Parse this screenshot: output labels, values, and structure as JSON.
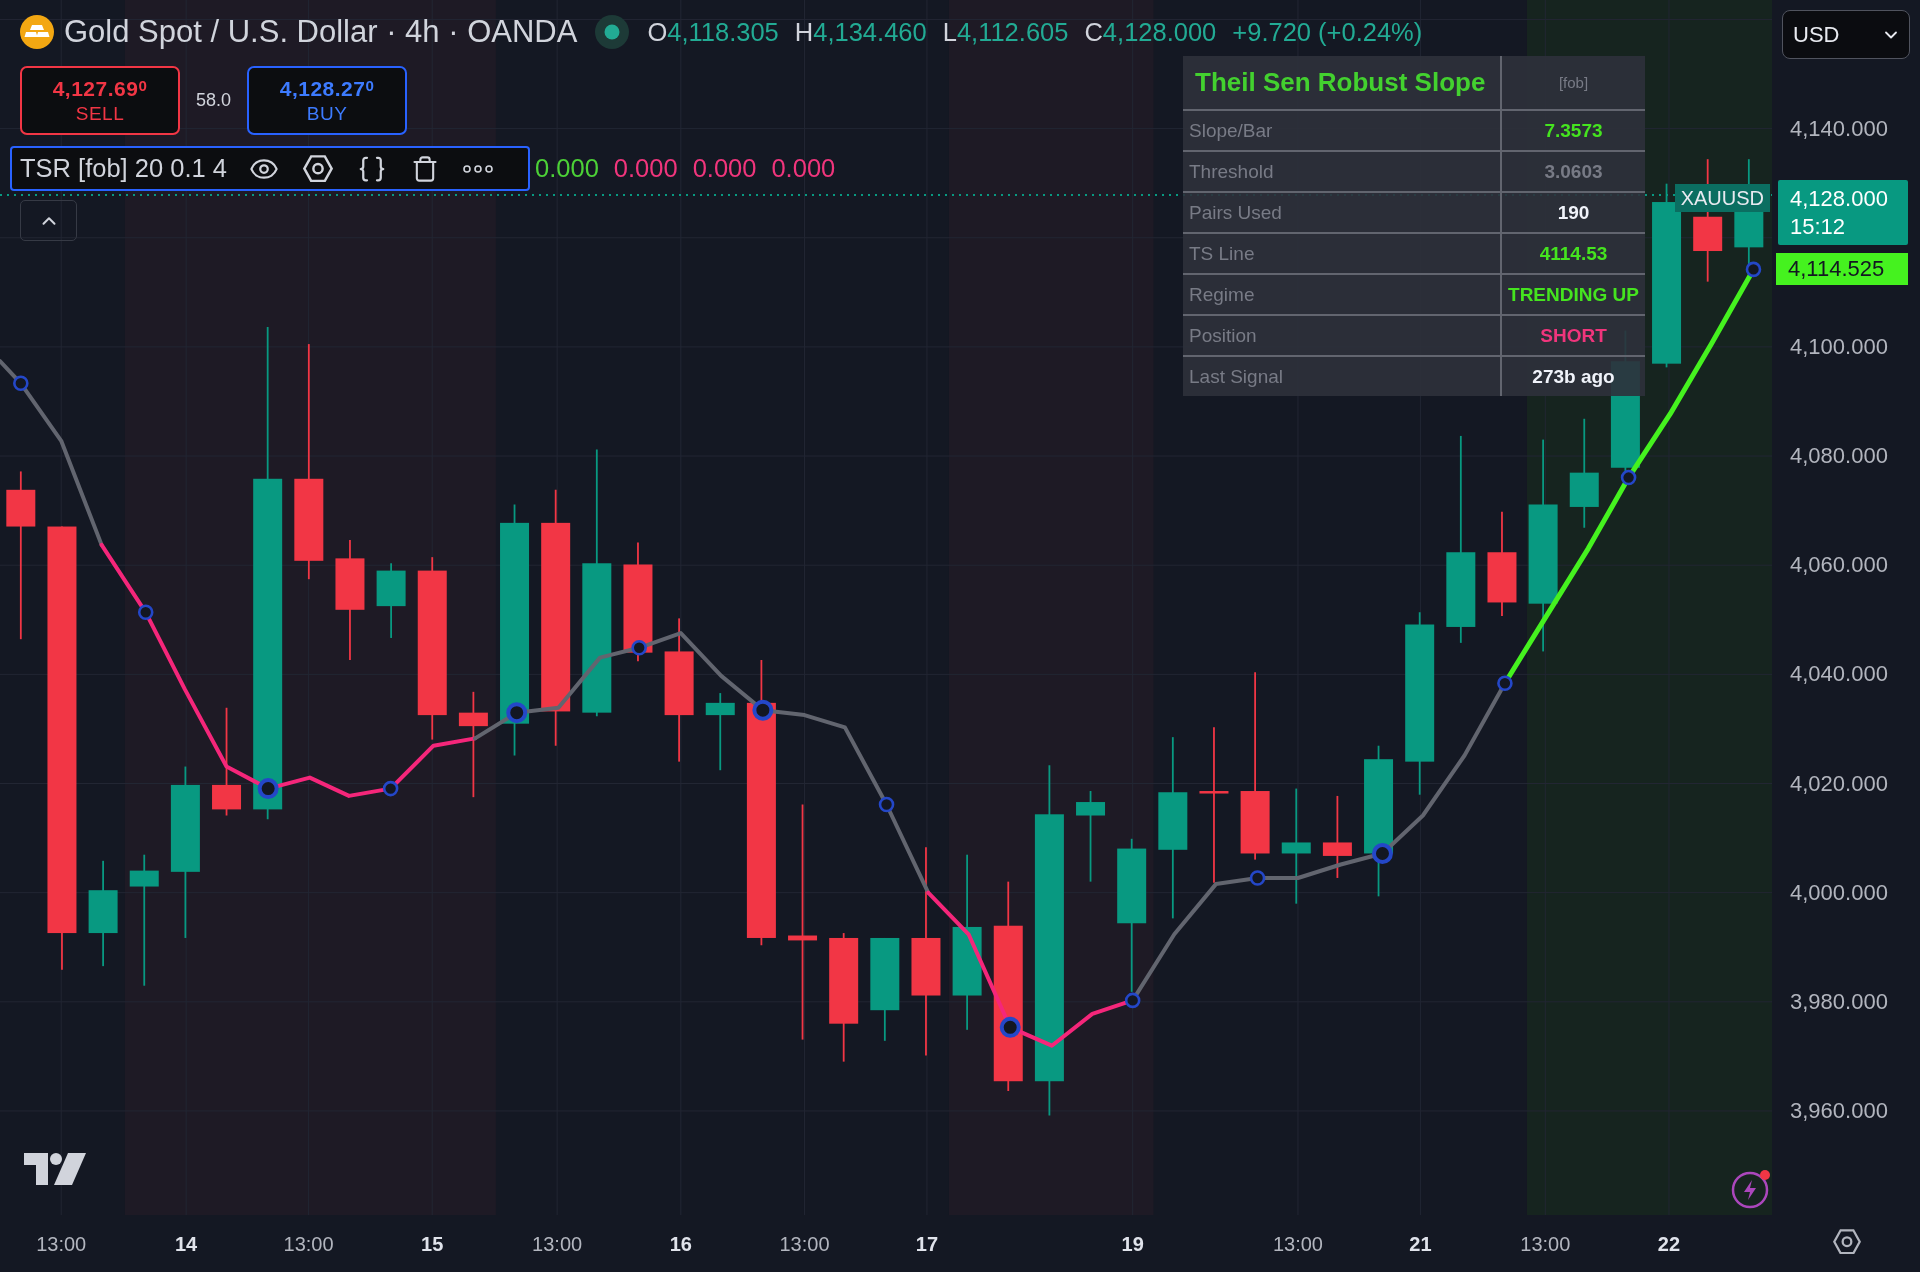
{
  "symbol_header": {
    "title": "Gold Spot / U.S. Dollar · 4h · OANDA",
    "market_open": true,
    "ohlc": [
      {
        "label": "O",
        "value": "4,118.305"
      },
      {
        "label": "H",
        "value": "4,134.460"
      },
      {
        "label": "L",
        "value": "4,112.605"
      },
      {
        "label": "C",
        "value": "4,128.000"
      }
    ],
    "change": "+9.720 (+0.24%)"
  },
  "trade_panel": {
    "sell": {
      "price": "4,127.69$^{0}$",
      "label": "SELL"
    },
    "spread": "58.0",
    "buy": {
      "price": "4,128.27$^{0}$",
      "label": "BUY"
    }
  },
  "indicator_legend": {
    "name": "TSR [fob] 20 0.1 4",
    "values": [
      {
        "text": "0.000",
        "color": "#4cd137"
      },
      {
        "text": "0.000",
        "color": "#f0357c"
      },
      {
        "text": "0.000",
        "color": "#f0357c"
      },
      {
        "text": "0.000",
        "color": "#f0357c"
      }
    ]
  },
  "stats_table": {
    "title": "Theil Sen Robust Slope",
    "tag": "[fob]",
    "rows": [
      {
        "label": "Slope/Bar",
        "value": "7.3573",
        "color": "#45e41f"
      },
      {
        "label": "Threshold",
        "value": "3.0603",
        "color": "#787b86"
      },
      {
        "label": "Pairs Used",
        "value": "190",
        "color": "#f0f3fa"
      },
      {
        "label": "TS Line",
        "value": "4114.53",
        "color": "#45e41f"
      },
      {
        "label": "Regime",
        "value": "TRENDING UP",
        "color": "#45e41f"
      },
      {
        "label": "Position",
        "value": "SHORT",
        "color": "#f0357c"
      },
      {
        "label": "Last Signal",
        "value": "273b ago",
        "color": "#f0f3fa"
      }
    ]
  },
  "price_axis": {
    "currency": "USD",
    "symbol_tag": "XAUUSD",
    "last_price": "4,128.000",
    "countdown": "15:12",
    "ts_line_price": "4,114.525",
    "labels": [
      "4,140.000",
      "4,100.000",
      "4,080.000",
      "4,060.000",
      "4,040.000",
      "4,020.000",
      "4,000.000",
      "3,980.000",
      "3,960.000"
    ]
  },
  "time_axis": {
    "labels": [
      {
        "text": "13:00",
        "kind": "time"
      },
      {
        "text": "14",
        "kind": "day"
      },
      {
        "text": "13:00",
        "kind": "time"
      },
      {
        "text": "15",
        "kind": "day"
      },
      {
        "text": "13:00",
        "kind": "time"
      },
      {
        "text": "16",
        "kind": "day"
      },
      {
        "text": "13:00",
        "kind": "time"
      },
      {
        "text": "17",
        "kind": "day"
      },
      {
        "text": "19",
        "kind": "day"
      },
      {
        "text": "13:00",
        "kind": "time"
      },
      {
        "text": "21",
        "kind": "day"
      },
      {
        "text": "13:00",
        "kind": "time"
      },
      {
        "text": "22",
        "kind": "day"
      }
    ]
  }
}
